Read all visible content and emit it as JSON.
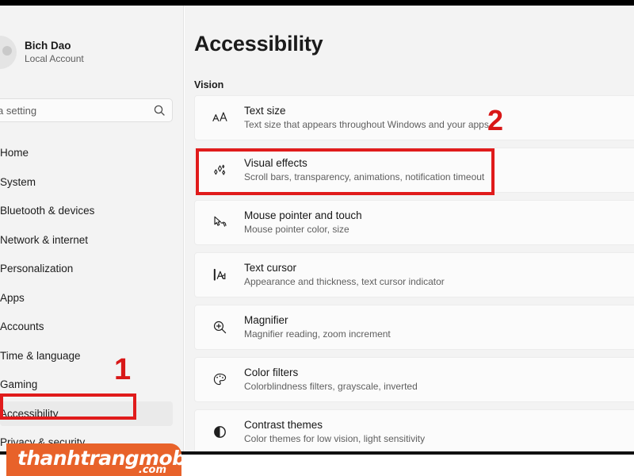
{
  "app": {
    "title": "Accessibility"
  },
  "sidebar": {
    "account": {
      "name": "Bich Dao",
      "type": "Local Account",
      "avatar_icon": "user-avatar-icon"
    },
    "search": {
      "value": "a setting",
      "placeholder": "Find a setting",
      "icon": "search-icon"
    },
    "items": [
      {
        "label": "Home",
        "selected": false
      },
      {
        "label": "System",
        "selected": false
      },
      {
        "label": "Bluetooth & devices",
        "selected": false
      },
      {
        "label": "Network & internet",
        "selected": false
      },
      {
        "label": "Personalization",
        "selected": false
      },
      {
        "label": "Apps",
        "selected": false
      },
      {
        "label": "Accounts",
        "selected": false
      },
      {
        "label": "Time & language",
        "selected": false
      },
      {
        "label": "Gaming",
        "selected": false
      },
      {
        "label": "Accessibility",
        "selected": true
      },
      {
        "label": "Privacy & security",
        "selected": false
      }
    ]
  },
  "main": {
    "heading": "Accessibility",
    "section": "Vision",
    "rows": [
      {
        "title": "Text size",
        "subtitle": "Text size that appears throughout Windows and your apps",
        "icon": "text-size-icon",
        "highlighted": false
      },
      {
        "title": "Visual effects",
        "subtitle": "Scroll bars, transparency, animations, notification timeout",
        "icon": "visual-effects-icon",
        "highlighted": true
      },
      {
        "title": "Mouse pointer and touch",
        "subtitle": "Mouse pointer color, size",
        "icon": "mouse-pointer-icon",
        "highlighted": false
      },
      {
        "title": "Text cursor",
        "subtitle": "Appearance and thickness, text cursor indicator",
        "icon": "text-cursor-icon",
        "highlighted": false
      },
      {
        "title": "Magnifier",
        "subtitle": "Magnifier reading, zoom increment",
        "icon": "magnifier-icon",
        "highlighted": false
      },
      {
        "title": "Color filters",
        "subtitle": "Colorblindness filters, grayscale, inverted",
        "icon": "color-filters-icon",
        "highlighted": false
      },
      {
        "title": "Contrast themes",
        "subtitle": "Color themes for low vision, light sensitivity",
        "icon": "contrast-themes-icon",
        "highlighted": false
      }
    ]
  },
  "annotations": {
    "color": "#e01b1b",
    "step_one": "1",
    "step_two": "2"
  },
  "watermark": {
    "name": "thanhtrangmobile",
    "tld": ".com",
    "color": "#e8622a"
  }
}
